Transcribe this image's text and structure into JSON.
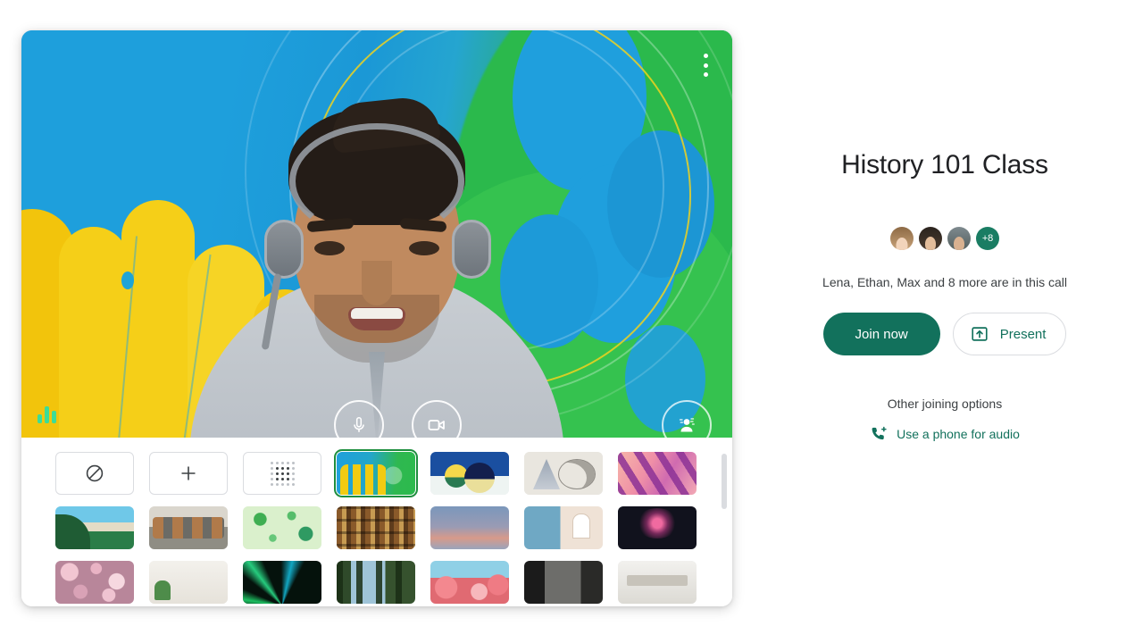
{
  "preview": {
    "more_menu_label": "More options",
    "audio_meter_label": "Audio level",
    "controls": [
      {
        "name": "microphone-toggle",
        "icon": "microphone-icon",
        "state": "on"
      },
      {
        "name": "camera-toggle",
        "icon": "video-camera-icon",
        "state": "on"
      },
      {
        "name": "visual-effects",
        "icon": "effects-person-icon",
        "state": "on"
      }
    ]
  },
  "backgrounds": {
    "scrollbar": {
      "name": "backgrounds-scrollbar"
    },
    "tiles": [
      {
        "id": "no-effect",
        "type": "control",
        "icon": "no-effect-icon",
        "label": "No effect",
        "selected": false
      },
      {
        "id": "add-image",
        "type": "control",
        "icon": "plus-icon",
        "label": "Add image",
        "selected": false
      },
      {
        "id": "blur",
        "type": "control",
        "icon": "blur-dots-icon",
        "label": "Blur background",
        "selected": false
      },
      {
        "id": "abstract-1",
        "type": "image",
        "art": "art-abstract1",
        "label": "Abstract yellow blue green",
        "selected": true
      },
      {
        "id": "abstract-2",
        "type": "image",
        "art": "art-abstract2",
        "label": "Abstract spheres",
        "selected": false
      },
      {
        "id": "abstract-3",
        "type": "image",
        "art": "art-abstract3",
        "label": "Abstract line sketch",
        "selected": false
      },
      {
        "id": "abstract-4",
        "type": "image",
        "art": "art-abstract4",
        "label": "Abstract pink purple",
        "selected": false
      },
      {
        "id": "beach",
        "type": "image",
        "art": "art-beach",
        "label": "Tropical beach",
        "selected": false
      },
      {
        "id": "horses",
        "type": "image",
        "art": "art-horses",
        "label": "Horses",
        "selected": false
      },
      {
        "id": "green-pattern",
        "type": "image",
        "art": "art-green-pattern",
        "label": "Green leaf pattern",
        "selected": false
      },
      {
        "id": "bookshelf",
        "type": "image",
        "art": "art-books",
        "label": "Bookshelf",
        "selected": false
      },
      {
        "id": "sunset",
        "type": "image",
        "art": "art-sunset",
        "label": "Sunset gradient",
        "selected": false
      },
      {
        "id": "coast",
        "type": "image",
        "art": "art-coast",
        "label": "Coastal village",
        "selected": false
      },
      {
        "id": "fireworks",
        "type": "image",
        "art": "art-fireworks",
        "label": "Fireworks",
        "selected": false
      },
      {
        "id": "blossom",
        "type": "image",
        "art": "art-blossom",
        "label": "Pink blossoms",
        "selected": false
      },
      {
        "id": "interior",
        "type": "image",
        "art": "art-interior",
        "label": "White interior",
        "selected": false
      },
      {
        "id": "green-light",
        "type": "image",
        "art": "art-greenlight",
        "label": "Green stage lights",
        "selected": false
      },
      {
        "id": "forest",
        "type": "image",
        "art": "art-forest",
        "label": "Forest lake",
        "selected": false
      },
      {
        "id": "flowers",
        "type": "image",
        "art": "art-flowers",
        "label": "Pink flowers sky",
        "selected": false
      },
      {
        "id": "dark-room",
        "type": "image",
        "art": "art-darkroom",
        "label": "Dark room",
        "selected": false
      },
      {
        "id": "kitchen",
        "type": "image",
        "art": "art-kitchen",
        "label": "Modern kitchen",
        "selected": false
      }
    ]
  },
  "join": {
    "title": "History 101 Class",
    "participant_overflow": "+8",
    "participants_line": "Lena, Ethan, Max and 8 more are in this call",
    "join_label": "Join now",
    "present_label": "Present",
    "other_options_label": "Other joining options",
    "phone_audio_label": "Use a phone for audio"
  },
  "colors": {
    "brand_green": "#12715c",
    "avatar_badge": "#1a7d63",
    "selected_outline": "#1e8e3e",
    "text_primary": "#202124",
    "text_secondary": "#3c4043"
  }
}
